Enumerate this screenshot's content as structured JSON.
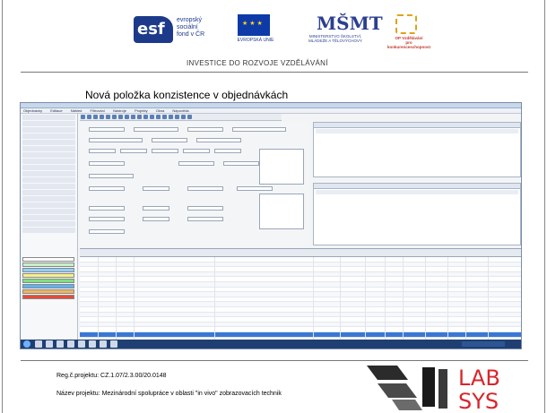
{
  "header": {
    "esf_lines": [
      "evropský",
      "sociální",
      "fond v ČR"
    ],
    "esf_mark": "esf",
    "eu_label": "EVROPSKÁ UNIE",
    "msmt_mark": "MŠMT",
    "msmt_lines": [
      "MINISTERSTVO ŠKOLSTVÍ,",
      "MLÁDEŽE A TĚLOVÝCHOVY"
    ],
    "op_lines": [
      "OP Vzdělávání",
      "pro konkurenceschopnost"
    ],
    "tagline": "INVESTICE DO ROZVOJE VZDĚLÁVÁNÍ"
  },
  "slide": {
    "headline": "Nová položka konzistence v objednávkách"
  },
  "screenshot": {
    "menu": [
      "Objednávky",
      "Editace",
      "Náhled",
      "Filtrování",
      "Nástroje",
      "Projekty",
      "Okna",
      "Nápověda"
    ]
  },
  "footer": {
    "reg": "Reg.č.projektu: CZ.1.07/2.3.00/20.0148",
    "project": "Název projektu: Mezinárodní spolupráce v oblasti \"in vivo\" zobrazovacích technik"
  },
  "lab_logo": {
    "top": "LAB",
    "bottom": "SYS"
  },
  "colors": {
    "esf_blue": "#1d3a8a",
    "eu_flag": "#0d3aa8",
    "selection": "#3b77d6",
    "taskbar": "#1f3f73",
    "lab_red": "#d7262c"
  }
}
